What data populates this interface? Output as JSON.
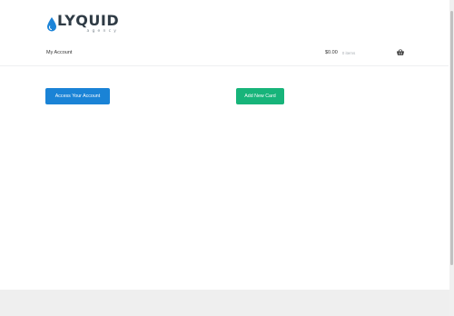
{
  "header": {
    "logo_word": "LYQUID",
    "logo_sub": "agency",
    "nav_link": "My Account",
    "cart_amount": "$0.00",
    "cart_count": "0 items"
  },
  "main": {
    "access_button": "Access Your Account",
    "add_card_button": "Add New Card"
  },
  "colors": {
    "brand_drop": "#1c84d8",
    "access_button": "#1a83d6",
    "add_card_button": "#17b47a"
  },
  "icons": {
    "logo": "water-drop-icon",
    "cart": "basket-icon"
  }
}
